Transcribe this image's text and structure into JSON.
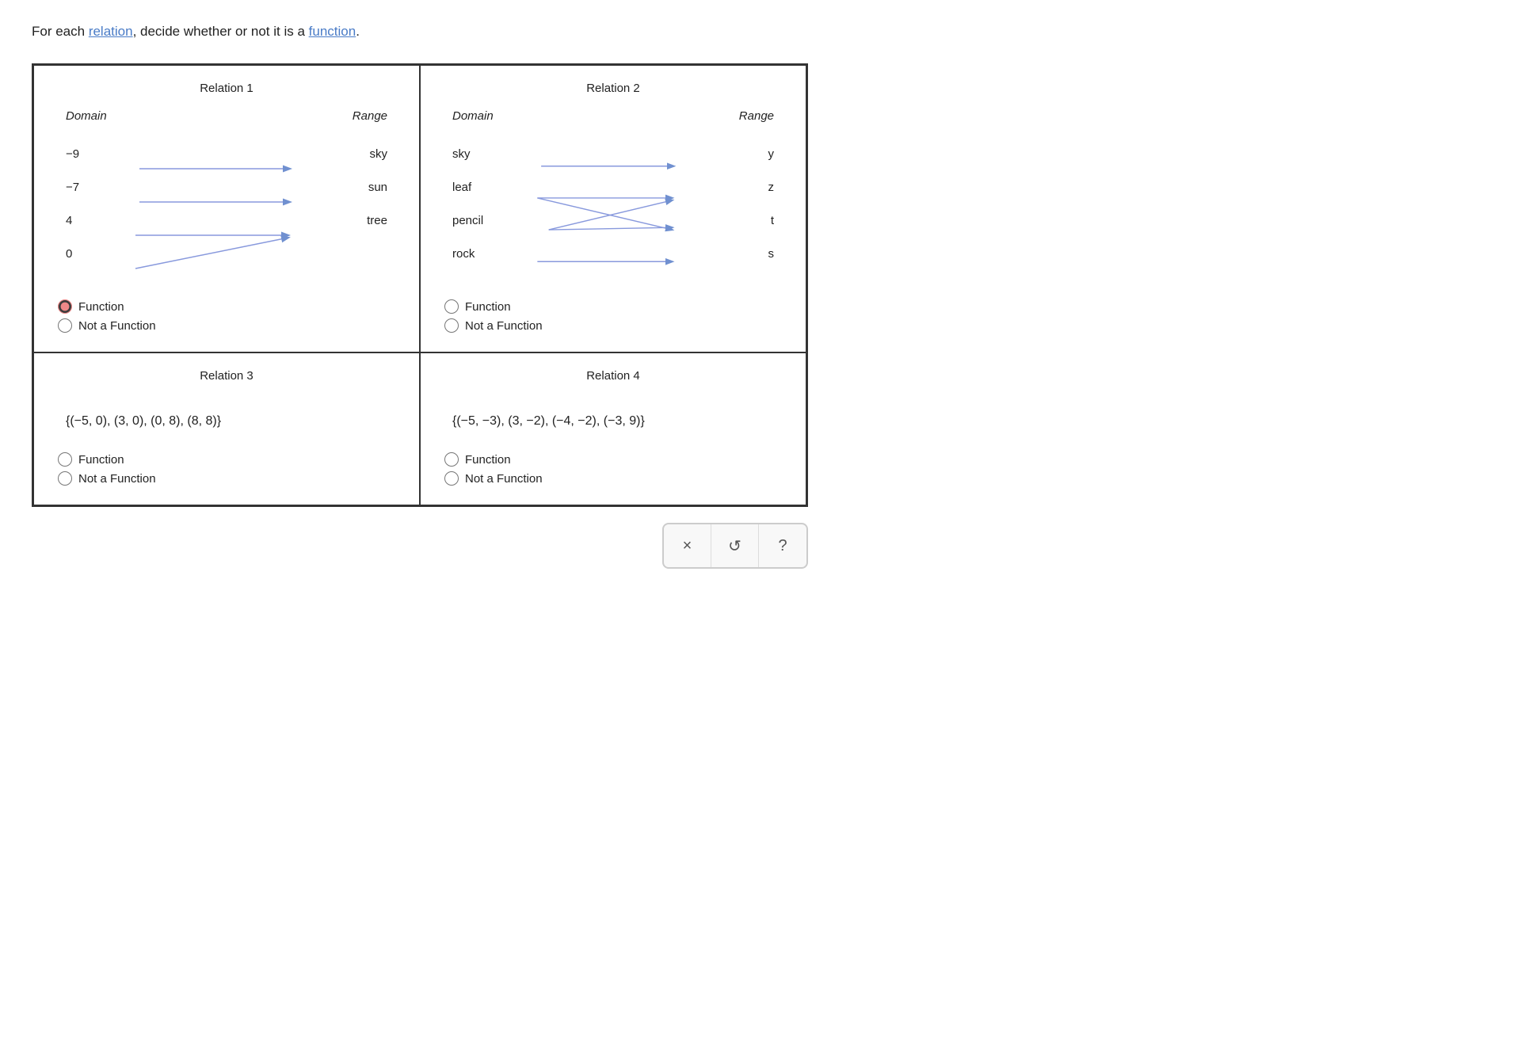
{
  "intro": {
    "text_before": "For each ",
    "link1": "relation",
    "text_mid": ", decide whether or not it is a ",
    "link2": "function",
    "text_after": "."
  },
  "relations": [
    {
      "id": "relation1",
      "title": "Relation 1",
      "type": "mapping",
      "domain_header": "Domain",
      "range_header": "Range",
      "domain_items": [
        "-9",
        "-7",
        "4",
        "0"
      ],
      "range_items": [
        "sky",
        "sun",
        "tree"
      ],
      "arrows": [
        {
          "from": 0,
          "to": 0
        },
        {
          "from": 1,
          "to": 1
        },
        {
          "from": 2,
          "to": 2
        },
        {
          "from": 3,
          "to": 2
        }
      ],
      "selected": "function",
      "options": [
        "Function",
        "Not a Function"
      ]
    },
    {
      "id": "relation2",
      "title": "Relation 2",
      "type": "mapping",
      "domain_header": "Domain",
      "range_header": "Range",
      "domain_items": [
        "sky",
        "leaf",
        "pencil",
        "rock"
      ],
      "range_items": [
        "y",
        "z",
        "t",
        "s"
      ],
      "arrows": [
        {
          "from": 0,
          "to": 0
        },
        {
          "from": 1,
          "to": 1
        },
        {
          "from": 1,
          "to": 2
        },
        {
          "from": 2,
          "to": 1
        },
        {
          "from": 2,
          "to": 2
        },
        {
          "from": 3,
          "to": 3
        }
      ],
      "selected": "none",
      "options": [
        "Function",
        "Not a Function"
      ]
    },
    {
      "id": "relation3",
      "title": "Relation 3",
      "type": "set",
      "set_notation": "{(-5, 0), (3, 0), (0, 8), (8, 8)}",
      "selected": "none",
      "options": [
        "Function",
        "Not a Function"
      ]
    },
    {
      "id": "relation4",
      "title": "Relation 4",
      "type": "set",
      "set_notation": "{(-5, -3), (3, -2), (-4, -2), (-3, 9)}",
      "selected": "none",
      "options": [
        "Function",
        "Not a Function"
      ]
    }
  ],
  "toolbar": {
    "close_label": "×",
    "undo_label": "↺",
    "help_label": "?"
  }
}
